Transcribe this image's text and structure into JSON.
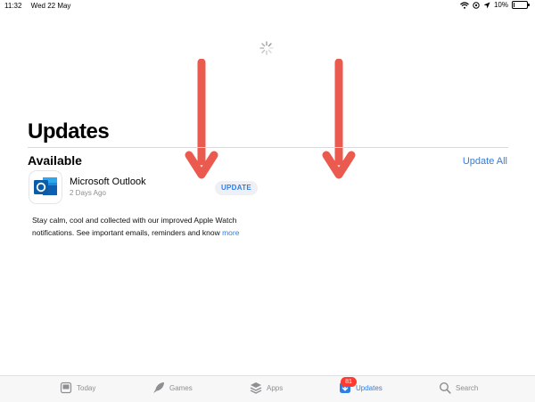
{
  "status_bar": {
    "time": "11:32",
    "date": "Wed 22 May",
    "battery": "10%",
    "battery_level": 0.1
  },
  "page": {
    "title": "Updates"
  },
  "section": {
    "title": "Available",
    "update_all": "Update All"
  },
  "app": {
    "name": "Microsoft Outlook",
    "date": "2 Days Ago",
    "button": "UPDATE",
    "notes": "Stay calm, cool and collected with our improved Apple Watch notifications. See important emails, reminders and know",
    "more": "more",
    "icon": "outlook-icon"
  },
  "tabs": [
    {
      "label": "Today",
      "icon": "today-icon"
    },
    {
      "label": "Games",
      "icon": "rocket-icon"
    },
    {
      "label": "Apps",
      "icon": "layers-icon"
    },
    {
      "label": "Updates",
      "icon": "download-icon",
      "badge": "81",
      "active": true
    },
    {
      "label": "Search",
      "icon": "search-icon"
    }
  ],
  "colors": {
    "accent": "#2f7ee6",
    "arrow": "#ea5a4f",
    "badge": "#ff3b30"
  }
}
